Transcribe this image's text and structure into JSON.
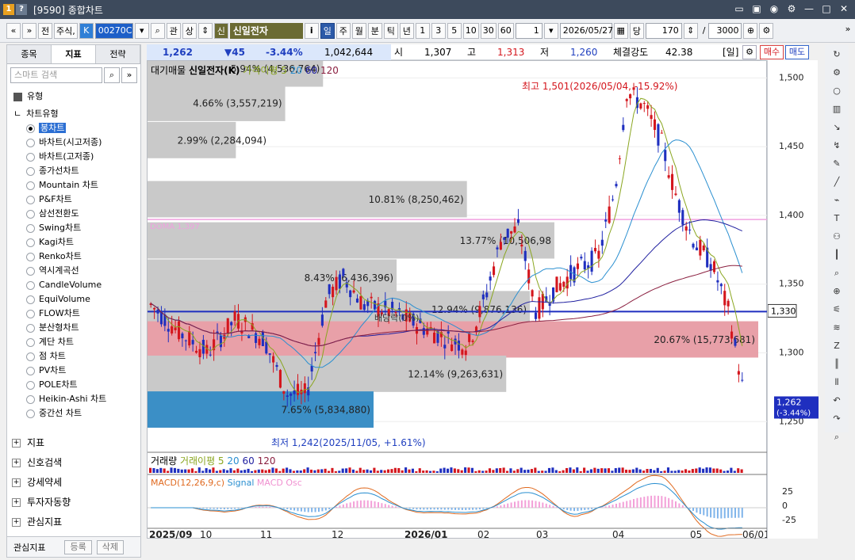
{
  "window": {
    "badge1": "1",
    "badge2": "?",
    "title": "[9590] 종합차트"
  },
  "toolbar": {
    "nav_prev": "«",
    "nav_down": "»",
    "btn_prev": "전",
    "btn_stock": "주식,",
    "k_badge": "K",
    "code": "00270C",
    "search_icon": "search-icon",
    "kwan": "관",
    "sang": "상",
    "sin_badge": "신",
    "stock_name": "신일전자",
    "info": "i",
    "periods": [
      "일",
      "주",
      "월",
      "분",
      "틱",
      "년"
    ],
    "minutes": [
      "1",
      "3",
      "5",
      "10",
      "30",
      "60"
    ],
    "unit_value": "1",
    "date": "2026/05/27",
    "dang": "당",
    "count": "170",
    "slash": "/",
    "total": "3000"
  },
  "leftpanel": {
    "tabs": [
      "종목",
      "지표",
      "전략"
    ],
    "search_placeholder": "스마트 검색",
    "group_label": "유형",
    "category": "차트유형",
    "chart_types": [
      "봉차트",
      "바차트(시고저종)",
      "바차트(고저종)",
      "종가선차트",
      "Mountain 차트",
      "P&F차트",
      "삼선전환도",
      "Swing차트",
      "Kagi차트",
      "Renko차트",
      "역시계곡선",
      "CandleVolume",
      "EquiVolume",
      "FLOW차트",
      "분산형차트",
      "계단 차트",
      "점 차트",
      "PV차트",
      "POLE차트",
      "Heikin-Ashi 차트",
      "중간선 차트"
    ],
    "sections": [
      "지표",
      "신호검색",
      "강세약세",
      "투자자동향",
      "관심지표"
    ],
    "bottom_label": "관심지표",
    "btn_register": "등록",
    "btn_delete": "삭제"
  },
  "quote": {
    "price": "1,262",
    "change": "▼45",
    "rate": "-3.44%",
    "volume": "1,042,644",
    "open_label": "시",
    "open": "1,307",
    "high_label": "고",
    "high": "1,313",
    "low_label": "저",
    "low": "1,260",
    "strength_label": "체결강도",
    "strength": "42.38",
    "period_tag": "[일]",
    "buy": "매수",
    "sell": "매도"
  },
  "legend": {
    "price": "대기매물",
    "stock": "신일전자(K)",
    "ma_label": "가격이평 5",
    "ma20": "20",
    "ma60": "60",
    "ma120": "120",
    "volume": "거래량",
    "vol_ma": "거래이평 5",
    "vol20": "20",
    "vol60": "60",
    "vol120": "120",
    "macd": "MACD(12,26,9,c)",
    "signal": "Signal",
    "osc": "MACD Osc"
  },
  "annotations": {
    "high": "최고 1,501(2026/05/04, -15.92%)",
    "low": "최저 1,242(2025/11/05, +1.61%)",
    "pref": "배당락(0%)",
    "dma": "DOMA 1,397"
  },
  "volume_profile": [
    {
      "label": "5.94% (4,536,764)",
      "pct": 5.94
    },
    {
      "label": "4.66% (3,557,219)",
      "pct": 4.66
    },
    {
      "label": "2.99% (2,284,094)",
      "pct": 2.99
    },
    {
      "label": "10.81% (8,250,462)",
      "pct": 10.81
    },
    {
      "label": "13.77% (10,506,98",
      "pct": 13.77
    },
    {
      "label": "8.43% (6,436,396)",
      "pct": 8.43
    },
    {
      "label": "12.94% (9,876,136)",
      "pct": 12.94
    },
    {
      "label": "20.67% (15,773,681)",
      "pct": 20.67
    },
    {
      "label": "12.14% (9,263,631)",
      "pct": 12.14
    },
    {
      "label": "7.65% (5,834,880)",
      "pct": 7.65
    }
  ],
  "axis": {
    "y_ticks": [
      "1,500",
      "1,450",
      "1,400",
      "1,350",
      "1,300",
      "1,250"
    ],
    "current_level": "1,330",
    "last_price": "1,262",
    "last_rate": "(-3.44%)",
    "macd_ticks": [
      "25",
      "0",
      "-25"
    ],
    "x_labels": [
      "2025/09",
      "10",
      "11",
      "12",
      "2026/01",
      "02",
      "03",
      "04",
      "05",
      "06/01"
    ]
  },
  "chart_data": {
    "type": "candlestick",
    "y_range": [
      1230,
      1510
    ],
    "last_price": 1262,
    "high": 1501,
    "low": 1242,
    "ref_line": 1330,
    "dma_line": 1397
  }
}
